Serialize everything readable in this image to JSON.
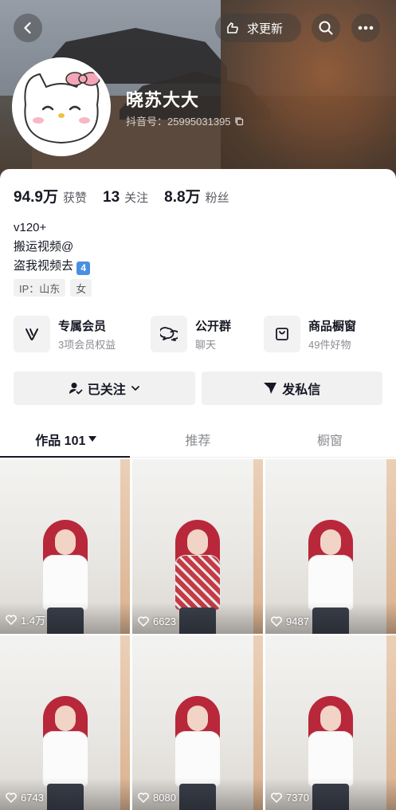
{
  "header": {
    "update_label": "求更新",
    "username": "晓苏大大",
    "douyin_id": "抖音号：25995031395"
  },
  "stats": [
    {
      "num": "94.9万",
      "label": "获赞"
    },
    {
      "num": "13",
      "label": "关注"
    },
    {
      "num": "8.8万",
      "label": "粉丝"
    }
  ],
  "bio": {
    "line1": "v120+",
    "line2": "搬运视频@",
    "line3": "盗我视频去",
    "keycap": "4"
  },
  "tags": [
    "IP：山东",
    "女"
  ],
  "features": [
    {
      "title": "专属会员",
      "sub": "3项会员权益",
      "icon": "v-icon"
    },
    {
      "title": "公开群",
      "sub": "聊天",
      "icon": "chat-icon"
    },
    {
      "title": "商品橱窗",
      "sub": "49件好物",
      "icon": "bag-icon"
    }
  ],
  "actions": {
    "following": "已关注",
    "message": "发私信"
  },
  "tabs": [
    {
      "label": "作品 101"
    },
    {
      "label": "推荐"
    },
    {
      "label": "橱窗"
    }
  ],
  "videos": [
    {
      "likes": "1.4万"
    },
    {
      "likes": "6623"
    },
    {
      "likes": "9487"
    },
    {
      "likes": "6743"
    },
    {
      "likes": "8080"
    },
    {
      "likes": "7370"
    }
  ],
  "colors": {
    "text": "#161823",
    "secondary": "#8a8b91",
    "button_bg": "#f1f1f2",
    "hair": "#b8283a"
  }
}
